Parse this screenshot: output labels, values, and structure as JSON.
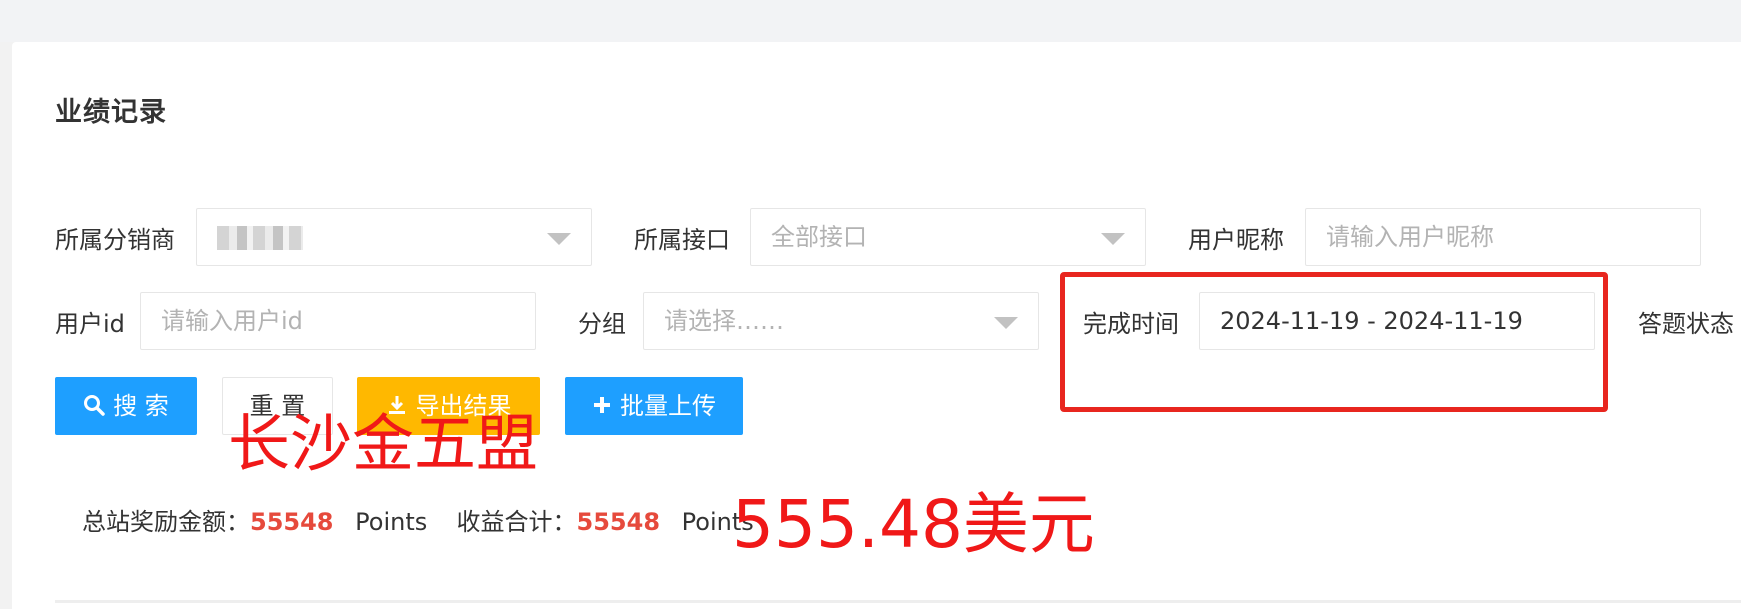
{
  "page": {
    "title": "业绩记录"
  },
  "filters": {
    "distributor": {
      "label": "所属分销商",
      "value": ""
    },
    "interface": {
      "label": "所属接口",
      "placeholder": "全部接口"
    },
    "nickname": {
      "label": "用户昵称",
      "placeholder": "请输入用户昵称"
    },
    "user_id": {
      "label": "用户id",
      "placeholder": "请输入用户id"
    },
    "group": {
      "label": "分组",
      "placeholder": "请选择……"
    },
    "complete_time": {
      "label": "完成时间",
      "value": "2024-11-19 - 2024-11-19"
    },
    "answer_status": {
      "label": "答题状态"
    }
  },
  "buttons": {
    "search": "搜 索",
    "reset": "重 置",
    "export": "导出结果",
    "upload": "批量上传"
  },
  "stats": {
    "total_reward_label": "总站奖励金额：",
    "total_reward_value": "55548",
    "total_reward_unit": "Points",
    "income_label": "收益合计：",
    "income_value": "55548",
    "income_unit": "Points"
  },
  "annotations": {
    "overlay_text_1": "长沙金五盟",
    "overlay_text_2": "555.48美元",
    "highlight_color": "#e8261f"
  },
  "colors": {
    "primary": "#1e9fff",
    "warm": "#ffb800",
    "stat_number": "#e64a3c"
  },
  "icons": [
    "search-icon",
    "download-icon",
    "plus-icon",
    "chevron-down-icon"
  ]
}
